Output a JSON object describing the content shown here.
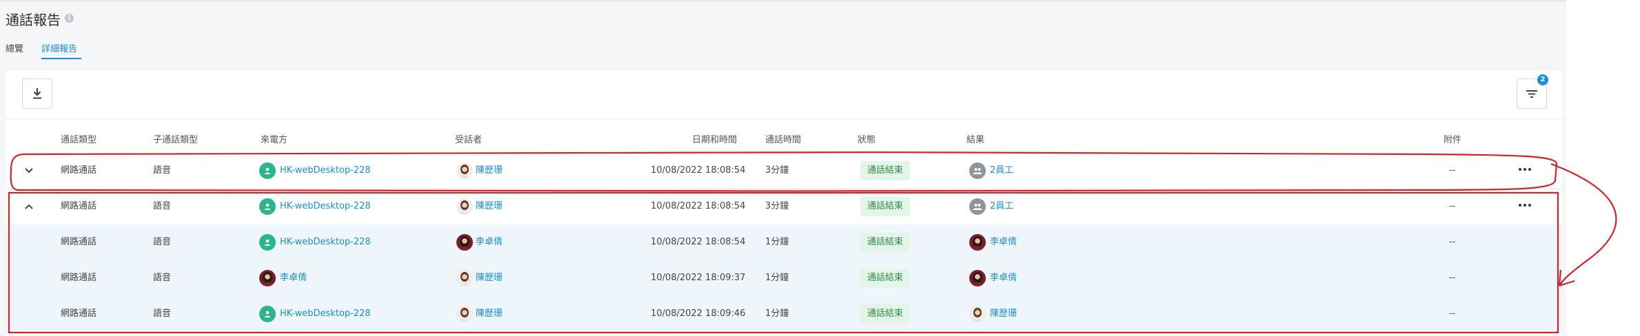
{
  "page": {
    "title": "通話報告"
  },
  "tabs": [
    {
      "label": "總覽",
      "active": false
    },
    {
      "label": "詳細報告",
      "active": true
    }
  ],
  "toolbar": {
    "filter_count": "2"
  },
  "columns": [
    "通話類型",
    "子通話類型",
    "來電方",
    "受話者",
    "日期和時間",
    "通話時間",
    "狀態",
    "結果",
    "附件"
  ],
  "rows": [
    {
      "kind": "parent",
      "expanded": false,
      "type": "網路通話",
      "subtype": "語音",
      "caller": "HK-webDesktop-228",
      "caller_avatar": "device",
      "callee": "陳歷珊",
      "callee_avatar": "woman",
      "datetime": "10/08/2022  18:08:54",
      "duration": "3分鐘",
      "status": "通話結束",
      "result": "2員工",
      "result_avatar": "group",
      "attachment": "--"
    },
    {
      "kind": "parent",
      "expanded": true,
      "type": "網路通話",
      "subtype": "語音",
      "caller": "HK-webDesktop-228",
      "caller_avatar": "device",
      "callee": "陳歷珊",
      "callee_avatar": "woman",
      "datetime": "10/08/2022  18:08:54",
      "duration": "3分鐘",
      "status": "通話結束",
      "result": "2員工",
      "result_avatar": "group",
      "attachment": "--"
    },
    {
      "kind": "sub",
      "type": "網路通話",
      "subtype": "語音",
      "caller": "HK-webDesktop-228",
      "caller_avatar": "device",
      "callee": "李卓倩",
      "callee_avatar": "dark",
      "datetime": "10/08/2022  18:08:54",
      "duration": "1分鐘",
      "status": "通話結束",
      "result": "李卓倩",
      "result_avatar": "dark",
      "attachment": "--"
    },
    {
      "kind": "sub",
      "type": "網路通話",
      "subtype": "語音",
      "caller": "李卓倩",
      "caller_avatar": "dark",
      "callee": "陳歷珊",
      "callee_avatar": "woman",
      "datetime": "10/08/2022  18:09:37",
      "duration": "1分鐘",
      "status": "通話結束",
      "result": "李卓倩",
      "result_avatar": "dark",
      "attachment": "--"
    },
    {
      "kind": "sub",
      "type": "網路通話",
      "subtype": "語音",
      "caller": "HK-webDesktop-228",
      "caller_avatar": "device",
      "callee": "陳歷珊",
      "callee_avatar": "woman",
      "datetime": "10/08/2022  18:09:46",
      "duration": "1分鐘",
      "status": "通話結束",
      "result": "陳歷珊",
      "result_avatar": "woman",
      "attachment": "--"
    }
  ],
  "colors": {
    "accent": "#1a8fd8",
    "status_bg": "#e3f5e8",
    "status_text": "#2e8a4a",
    "annotation": "#d2232a",
    "sub_row_bg": "#eef6fc"
  }
}
